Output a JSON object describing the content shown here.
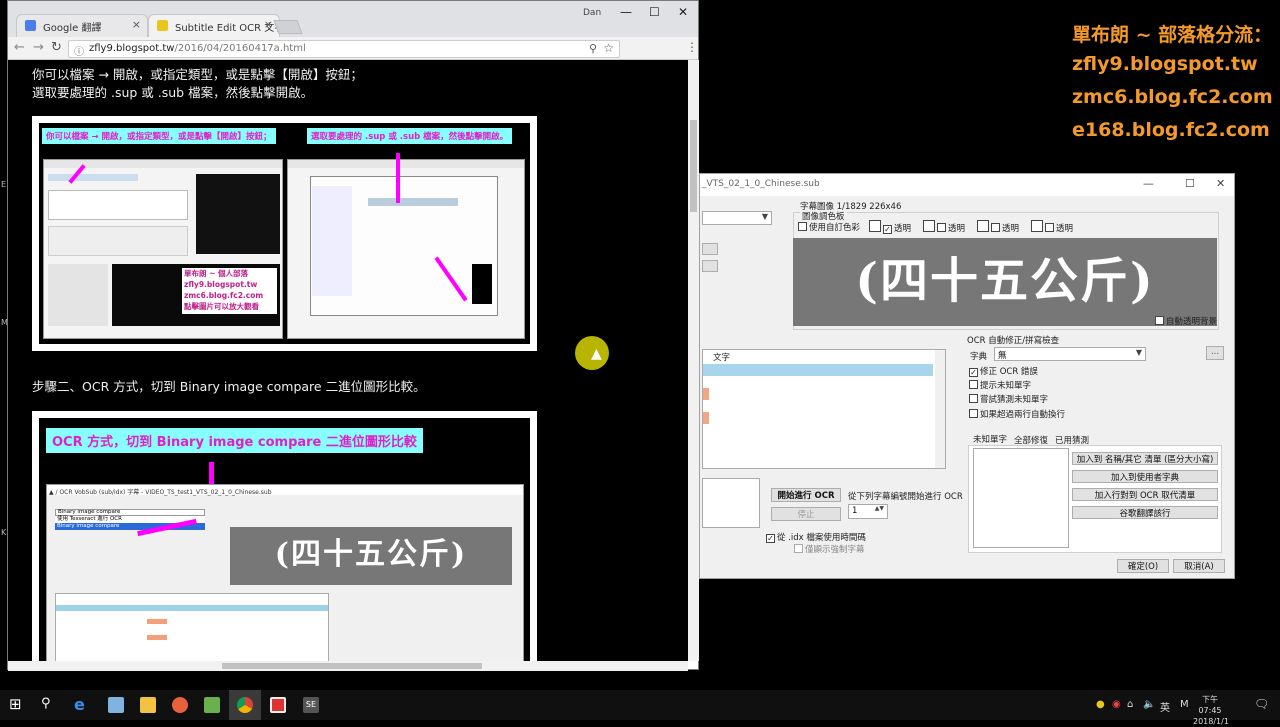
{
  "browser": {
    "tabs": [
      {
        "title": "Google 翻譯",
        "favicon_color": "#4a7de8"
      },
      {
        "title": "Subtitle Edit OCR 文字辨",
        "favicon_color": "#e8c620"
      }
    ],
    "user": "Dan",
    "url_host": "zfly9.blogspot.tw",
    "url_path": "/2016/04/20160417a.html",
    "menu_icon": "kebab-menu-icon"
  },
  "article": {
    "para1_line1": "你可以檔案 → 開啟，或指定類型，或是點擊【開啟】按鈕；",
    "para1_line2": "選取要處理的 .sup 或 .sub 檔案，然後點擊開啟。",
    "img1_cap_left": "你可以檔案 → 開啟，或指定類型，或是點擊【開啟】按鈕；",
    "img1_cap_right": "選取要處理的 .sup 或 .sub 檔案，然後點擊開啟。",
    "img1_blog": "單布朗 ~ 個人部落\nzfly9.blogspot.tw\nzmc6.blog.fc2.com\n點擊圖片可以放大觀看",
    "step2": "步驟二、OCR 方式，切到 Binary image compare 二進位圖形比較。",
    "img2_cap": "OCR 方式，切到 Binary image compare 二進位圖形比較",
    "img2_title": "▲ / OCR VobSub (sub/idx) 字幕 - VIDEO_TS_test1_VTS_02_1_0_Chinese.sub",
    "img2_ocr_text": "(四十五公斤)",
    "img2_dropdown_items": [
      "Binary image compare",
      "使用 Tesseract 進行 OCR",
      "Binary image compare"
    ]
  },
  "dialog": {
    "title": "_VTS_02_1_0_Chinese.sub",
    "subtitle_image_label": "字幕圖像 1/1829  226x46",
    "image_palette_label": "圖像調色板",
    "use_custom_color": "使用自訂色彩",
    "transparent": "透明",
    "ocr_text": "(四十五公斤)",
    "auto_transparent_bg": "自動透明背景",
    "list_header_text": "文字",
    "ocr_fix_group": "OCR 自動修正/拼寫檢查",
    "dictionary_label": "字典",
    "dictionary_value": "無",
    "fix_ocr_errors": "修正 OCR 錯誤",
    "prompt_unknown": "提示未知單字",
    "try_guess_unknown": "嘗試猜測未知單字",
    "auto_break_lines": "如果超過兩行自動換行",
    "tabs": [
      "未知單字",
      "全部修復",
      "已用猜測"
    ],
    "btn_add_names": "加入到 名稱/其它 清單 (區分大小寫)",
    "btn_add_user_dict": "加入到使用者字典",
    "btn_add_ocr_replace": "加入行對到 OCR 取代清單",
    "btn_google_it": "谷歌翻譯該行",
    "start_ocr": "開始進行 OCR",
    "stop": "停止",
    "start_from_label": "從下列字幕編號開始進行 OCR",
    "start_from_value": "1",
    "use_idx_times": "從 .idx 檔案使用時間碼",
    "only_forced": "僅顯示強制字幕",
    "ok": "確定(O)",
    "cancel": "取消(A)",
    "ellipsis": "..."
  },
  "overlay": {
    "title": "單布朗 ~ 部落格分流：",
    "lines": [
      "zfly9.blogspot.tw",
      "zmc6.blog.fc2.com",
      "e168.blog.fc2.com"
    ]
  },
  "taskbar": {
    "time": "下午 07:45",
    "date": "2018/1/1",
    "ime": "英",
    "ime_mode": "M",
    "icons": [
      "windows-start-icon",
      "search-icon",
      "edge-icon",
      "notepad-icon",
      "file-explorer-icon",
      "firefox-icon",
      "subtitle-edit-icon",
      "chrome-icon",
      "screen-recorder-icon",
      "se-app-icon"
    ]
  }
}
